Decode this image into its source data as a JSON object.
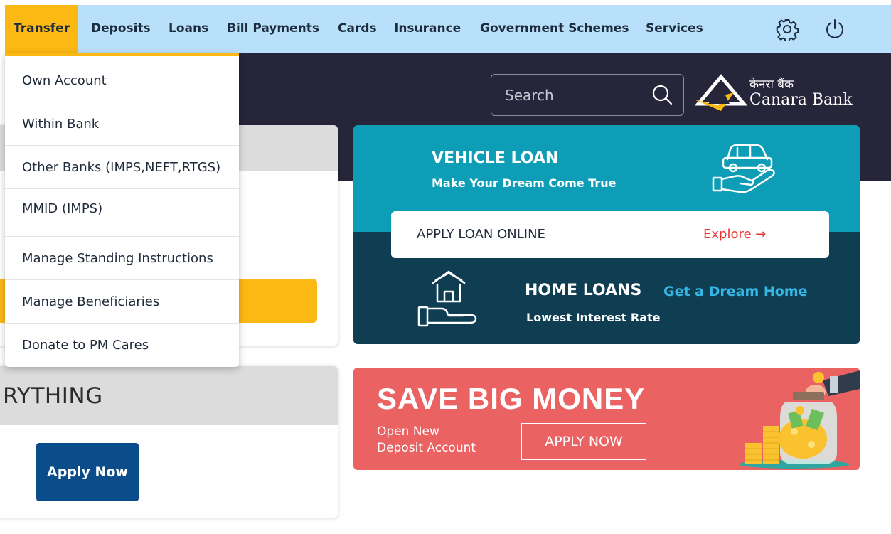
{
  "nav": {
    "items": [
      {
        "label": "Transfer",
        "active": true
      },
      {
        "label": "Deposits"
      },
      {
        "label": "Loans"
      },
      {
        "label": "Bill Payments"
      },
      {
        "label": "Cards"
      },
      {
        "label": "Insurance"
      },
      {
        "label": "Government Schemes"
      },
      {
        "label": "Services"
      }
    ],
    "icons": [
      "gear-icon",
      "power-icon"
    ]
  },
  "search": {
    "placeholder": "Search"
  },
  "logo": {
    "hindi": "केनरा बैंक",
    "english": "Canara Bank"
  },
  "transfer_menu": {
    "items": [
      "Own Account",
      "Within Bank",
      "Other Banks (IMPS,NEFT,RTGS)",
      "MMID (IMPS)",
      "Manage Standing Instructions",
      "Manage Beneficiaries",
      "Donate to PM Cares"
    ]
  },
  "left_cards": {
    "everything_text": "RYTHING",
    "apply_now_label": "Apply Now"
  },
  "vehicle_loan": {
    "title": "VEHICLE LOAN",
    "subtitle": "Make Your Dream Come True",
    "apply_text": "APPLY LOAN ONLINE",
    "explore_text": "Explore →"
  },
  "home_loans": {
    "title": "HOME LOANS",
    "tagline": "Get a Dream Home",
    "subtitle": "Lowest Interest Rate"
  },
  "save_money": {
    "title": "SAVE BIG MONEY",
    "sub_line1": "Open New",
    "sub_line2": "Deposit Account",
    "button_label": "APPLY NOW"
  },
  "colors": {
    "nav_bg": "#b9e0fb",
    "accent_yellow": "#fdb913",
    "hero_dark": "#262539",
    "vehicle_teal": "#0e9db6",
    "home_navy": "#0f3d52",
    "save_coral": "#ea6262",
    "explore_red": "#e8372f",
    "home_tag_blue": "#35b6e5",
    "apply_blue": "#0b4d8a"
  }
}
